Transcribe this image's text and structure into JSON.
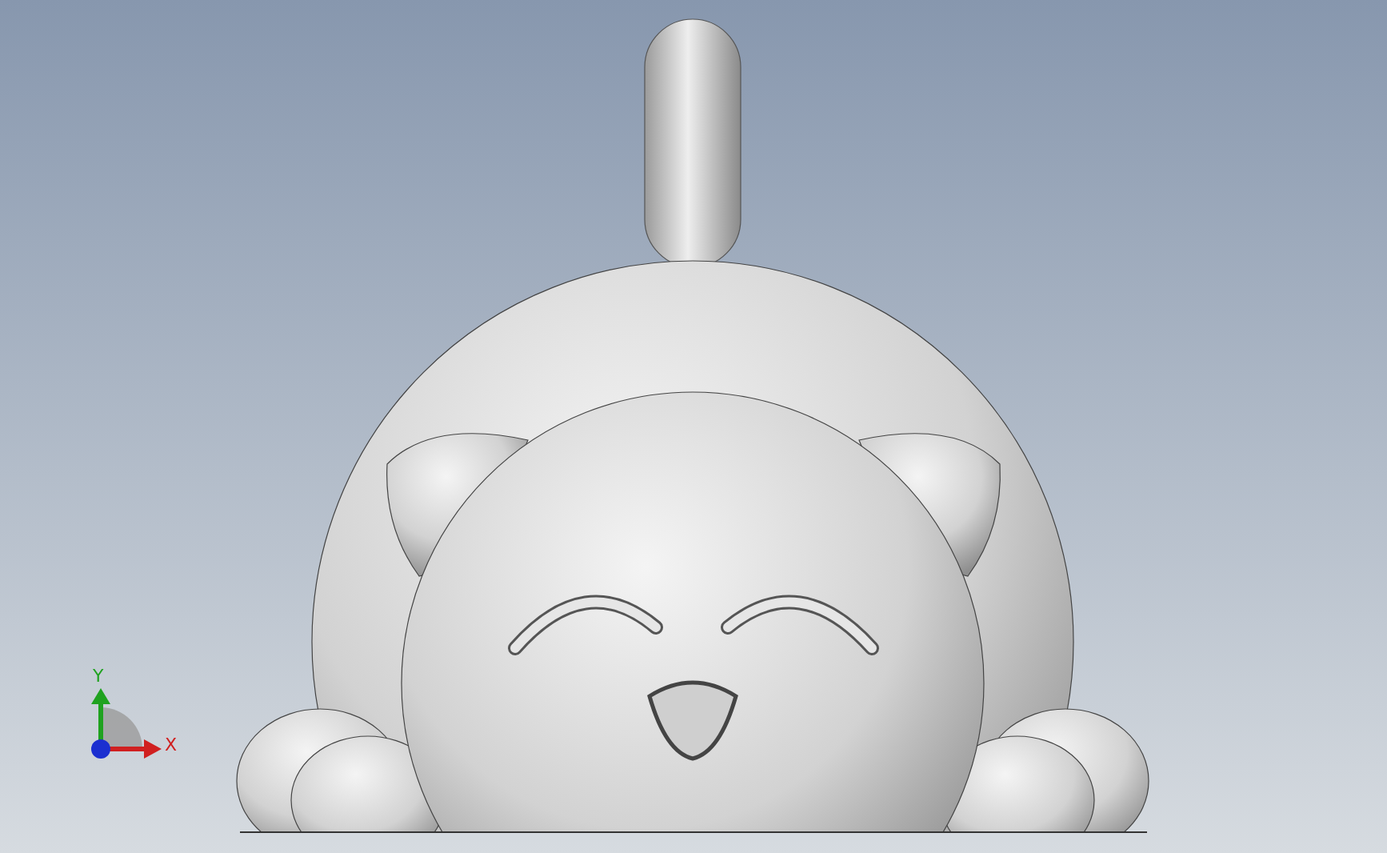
{
  "viewport": {
    "axis_triad": {
      "y_label": "Y",
      "x_label": "X"
    }
  }
}
